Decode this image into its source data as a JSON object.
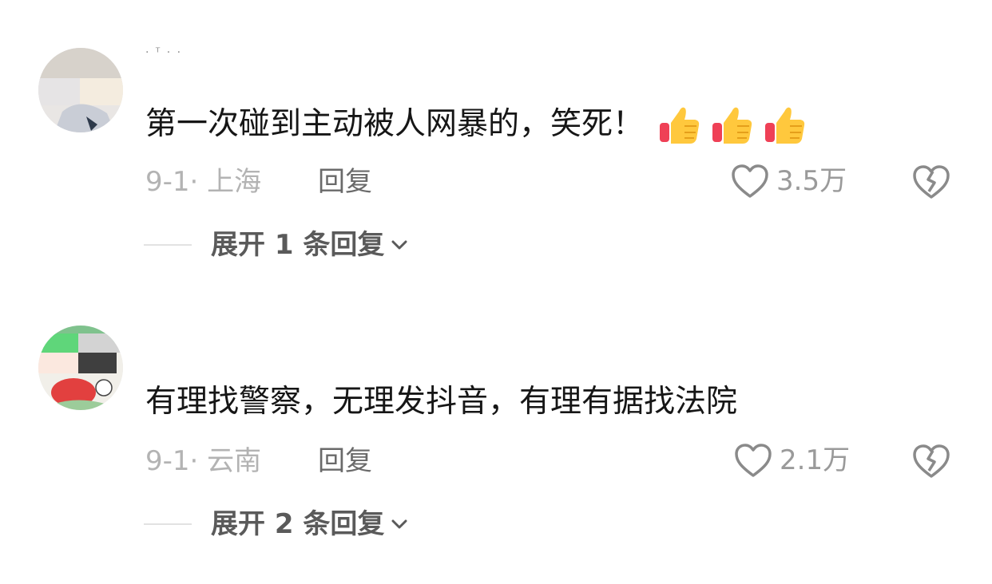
{
  "comments": [
    {
      "username": "· ᵀ · ·",
      "text": "第一次碰到主动被人网暴的，笑死！",
      "emojis": [
        "thumbs-up-icon",
        "thumbs-up-icon",
        "thumbs-up-icon"
      ],
      "date": "9-1",
      "location": "上海",
      "meta_sep": "· ",
      "reply_label": "回复",
      "likes": "3.5万",
      "expand_label": "展开 1 条回复"
    },
    {
      "username": "",
      "text": "有理找警察，无理发抖音，有理有据找法院",
      "emojis": [],
      "date": "9-1",
      "location": "云南",
      "meta_sep": "· ",
      "reply_label": "回复",
      "likes": "2.1万",
      "expand_label": "展开 2 条回复"
    }
  ],
  "colors": {
    "text_primary": "#161616",
    "text_meta": "#b3b3b3",
    "text_action": "#6a6a6a",
    "icon": "#8a8a8a",
    "emoji_yellow": "#ffc83d",
    "emoji_red": "#ef4056"
  }
}
